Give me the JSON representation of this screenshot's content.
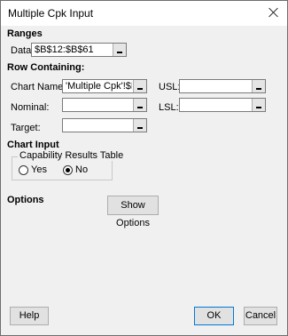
{
  "window": {
    "title": "Multiple Cpk Input"
  },
  "ranges": {
    "heading": "Ranges",
    "data_label": "Data",
    "data_value": "$B$12:$B$61"
  },
  "row_containing": {
    "heading": "Row Containing:",
    "chart_names_label": "Chart Names:",
    "chart_names_value": "'Multiple Cpk'!$B$6",
    "usl_label": "USL:",
    "usl_value": "",
    "nominal_label": "Nominal:",
    "nominal_value": "",
    "lsl_label": "LSL:",
    "lsl_value": "",
    "target_label": "Target:",
    "target_value": ""
  },
  "chart_input": {
    "heading": "Chart Input",
    "group_title": "Capability Results Table",
    "yes_label": "Yes",
    "no_label": "No",
    "selected": "No"
  },
  "options": {
    "heading": "Options",
    "show_options_label": "Show Options"
  },
  "footer": {
    "help_label": "Help",
    "ok_label": "OK",
    "cancel_label": "Cancel"
  }
}
